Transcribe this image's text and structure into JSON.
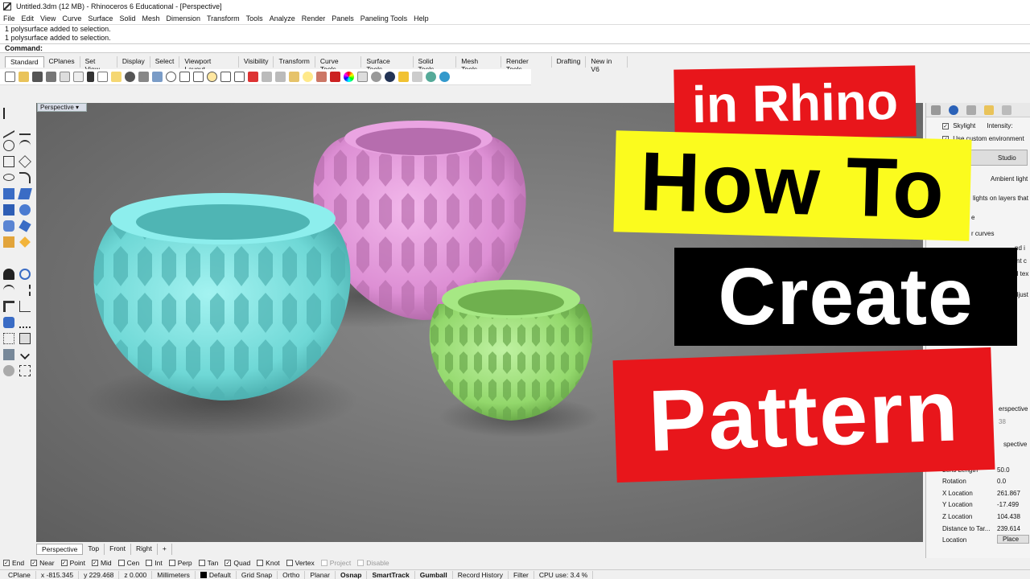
{
  "window": {
    "title": "Untitled.3dm (12 MB) - Rhinoceros 6 Educational - [Perspective]"
  },
  "menu": [
    "File",
    "Edit",
    "View",
    "Curve",
    "Surface",
    "Solid",
    "Mesh",
    "Dimension",
    "Transform",
    "Tools",
    "Analyze",
    "Render",
    "Panels",
    "Paneling Tools",
    "Help"
  ],
  "command_history": [
    "1 polysurface added to selection.",
    "1 polysurface added to selection."
  ],
  "command_prompt": "Command:",
  "toolbar_tabs": [
    "Standard",
    "CPlanes",
    "Set View",
    "Display",
    "Select",
    "Viewport Layout",
    "Visibility",
    "Transform",
    "Curve Tools",
    "Surface Tools",
    "Solid Tools",
    "Mesh Tools",
    "Render Tools",
    "Drafting",
    "New in V6"
  ],
  "viewport": {
    "label": "Perspective"
  },
  "viewport_tabs": [
    "Perspective",
    "Top",
    "Front",
    "Right",
    "+"
  ],
  "osnaps": [
    {
      "label": "End",
      "checked": true
    },
    {
      "label": "Near",
      "checked": true
    },
    {
      "label": "Point",
      "checked": true
    },
    {
      "label": "Mid",
      "checked": true
    },
    {
      "label": "Cen",
      "checked": false
    },
    {
      "label": "Int",
      "checked": false
    },
    {
      "label": "Perp",
      "checked": false
    },
    {
      "label": "Tan",
      "checked": false
    },
    {
      "label": "Quad",
      "checked": true
    },
    {
      "label": "Knot",
      "checked": false
    },
    {
      "label": "Vertex",
      "checked": false
    },
    {
      "label": "Project",
      "checked": false,
      "disabled": true
    },
    {
      "label": "Disable",
      "checked": false,
      "disabled": true
    }
  ],
  "status": {
    "cplane": "CPlane",
    "x": "x -815.345",
    "y": "y 229.468",
    "z": "z 0.000",
    "units": "Millimeters",
    "layer": "Default",
    "toggles": [
      "Grid Snap",
      "Ortho",
      "Planar",
      "Osnap",
      "SmartTrack",
      "Gumball",
      "Record History",
      "Filter"
    ],
    "bold_toggles": [
      "Osnap",
      "SmartTrack",
      "Gumball"
    ],
    "cpu": "CPU use: 3.4 %"
  },
  "right_panel": {
    "skylight_label": "Skylight",
    "intensity_label": "Intensity:",
    "custom_env_label": "Use custom environment",
    "studio_label": "Studio",
    "ambient_label": "Ambient light",
    "lights_layers_label": "lights on layers that",
    "frag_e": "e",
    "frag_curves": "r curves",
    "frag_ndi": "nd i",
    "frag_ntc": "nt c",
    "frag_dtex": "d tex",
    "frag_djust": "djust",
    "perspective_1": "erspective",
    "frag_38": "38",
    "perspective_2": "spective",
    "properties": [
      {
        "label": "Lens Length",
        "value": "50.0"
      },
      {
        "label": "Rotation",
        "value": "0.0"
      },
      {
        "label": "X Location",
        "value": "261.867"
      },
      {
        "label": "Y Location",
        "value": "-17.499"
      },
      {
        "label": "Z Location",
        "value": "104.438"
      },
      {
        "label": "Distance to Tar...",
        "value": "239.614"
      },
      {
        "label": "Location",
        "value": "Place"
      }
    ]
  },
  "thumbnail": {
    "line1": "in Rhino",
    "line2": "How To",
    "line3": "Create",
    "line4": "Pattern"
  },
  "colors": {
    "bowl_cyan": "#7fe3e1",
    "bowl_pink": "#e8a1de",
    "bowl_green": "#9fe27a",
    "banner_red": "#e8161b",
    "banner_yellow": "#fbfb1e",
    "banner_black": "#000000"
  }
}
